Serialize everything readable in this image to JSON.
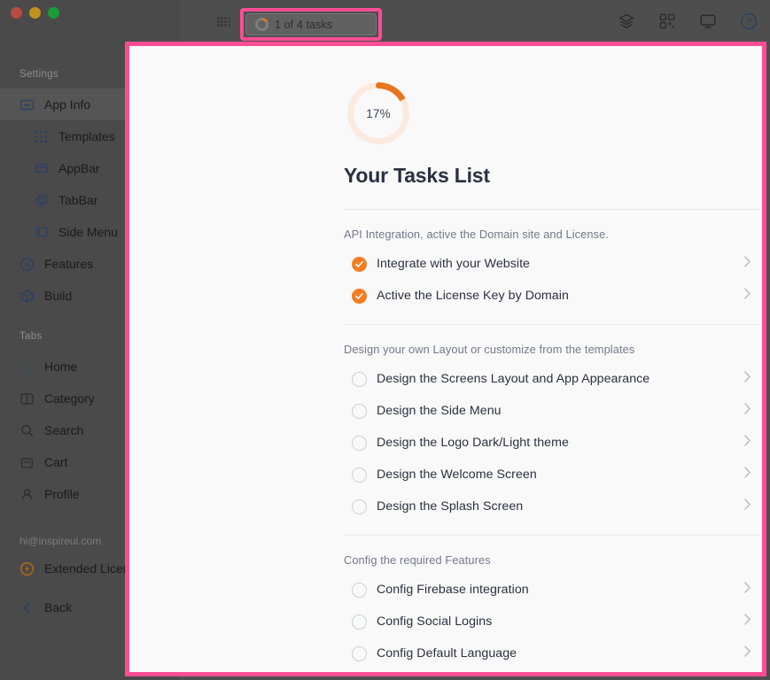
{
  "window": {
    "traffic_lights": [
      "close",
      "minimize",
      "zoom"
    ],
    "toolbar": {
      "grid_icon": "grid-apps-icon",
      "tasks_chip": {
        "label": "1 of 4 tasks",
        "progress_icon": "progress-ring-icon"
      },
      "right_icons": [
        {
          "name": "layers-icon",
          "title": "Layers"
        },
        {
          "name": "qr-code-icon",
          "title": "QR Code"
        },
        {
          "name": "monitor-icon",
          "title": "Preview"
        },
        {
          "name": "help-circle-icon",
          "title": "Help"
        }
      ]
    }
  },
  "sidebar": {
    "settings_title": "Settings",
    "settings_items": [
      {
        "label": "App Info",
        "icon": "app-info-icon",
        "active": true,
        "indent": false
      },
      {
        "label": "Templates",
        "icon": "templates-grid-icon",
        "active": false,
        "indent": true
      },
      {
        "label": "AppBar",
        "icon": "appbar-icon",
        "active": false,
        "indent": true
      },
      {
        "label": "TabBar",
        "icon": "tabbar-icon",
        "active": false,
        "indent": true
      },
      {
        "label": "Side Menu",
        "icon": "side-menu-icon",
        "active": false,
        "indent": true
      },
      {
        "label": "Features",
        "icon": "features-bolt-icon",
        "active": false,
        "indent": false
      },
      {
        "label": "Build",
        "icon": "build-box-icon",
        "active": false,
        "indent": false
      }
    ],
    "tabs_title": "Tabs",
    "tabs_items": [
      {
        "label": "Home",
        "icon": "home-icon"
      },
      {
        "label": "Category",
        "icon": "category-columns-icon"
      },
      {
        "label": "Search",
        "icon": "search-icon"
      },
      {
        "label": "Cart",
        "icon": "cart-bag-icon"
      },
      {
        "label": "Profile",
        "icon": "profile-person-icon"
      }
    ],
    "account_email": "hi@inspireui.com",
    "license_label": "Extended Licen",
    "license_icon": "license-bolt-icon",
    "back_label": "Back",
    "back_icon": "chevron-left-icon"
  },
  "panel": {
    "progress": {
      "percent_label": "17%",
      "percent_value": 17
    },
    "title": "Your Tasks List",
    "sections": [
      {
        "heading": "API Integration, active the Domain site and License.",
        "tasks": [
          {
            "label": "Integrate with your Website",
            "done": true
          },
          {
            "label": "Active the License Key by Domain",
            "done": true
          }
        ]
      },
      {
        "heading": "Design your own Layout or customize from the templates",
        "tasks": [
          {
            "label": "Design the Screens Layout and App Appearance",
            "done": false
          },
          {
            "label": "Design the Side Menu",
            "done": false
          },
          {
            "label": "Design the Logo Dark/Light theme",
            "done": false
          },
          {
            "label": "Design the Welcome Screen",
            "done": false
          },
          {
            "label": "Design the Splash Screen",
            "done": false
          }
        ]
      },
      {
        "heading": "Config the required Features",
        "tasks": [
          {
            "label": "Config Firebase integration",
            "done": false
          },
          {
            "label": "Config Social Logins",
            "done": false
          },
          {
            "label": "Config Default Language",
            "done": false
          }
        ]
      }
    ]
  },
  "colors": {
    "accent_orange": "#F57C20",
    "highlight_pink": "#fc4d93",
    "icon_navy": "#2b4061",
    "panel_bg": "#f9f9f9",
    "sidebar_bg": "#4a4a4a"
  }
}
